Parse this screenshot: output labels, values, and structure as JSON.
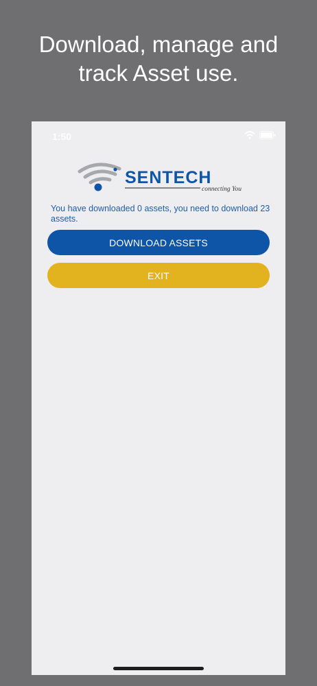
{
  "promo": {
    "headline_line1": "Download, manage and",
    "headline_line2": "track Asset use."
  },
  "status_bar": {
    "time": "1:50"
  },
  "logo": {
    "brand": "SENTECH",
    "tagline": "connecting You"
  },
  "main": {
    "message": "You have downloaded 0 assets, you need to download 23 assets.",
    "download_button_label": "DOWNLOAD ASSETS",
    "exit_button_label": "EXIT"
  },
  "colors": {
    "primary_blue": "#0e54a7",
    "exit_yellow": "#e2b21f",
    "background": "#eeedf0",
    "outer_gray": "#6f6e71"
  },
  "icons": [
    "wifi-icon",
    "battery-icon",
    "sentech-logo-icon"
  ]
}
